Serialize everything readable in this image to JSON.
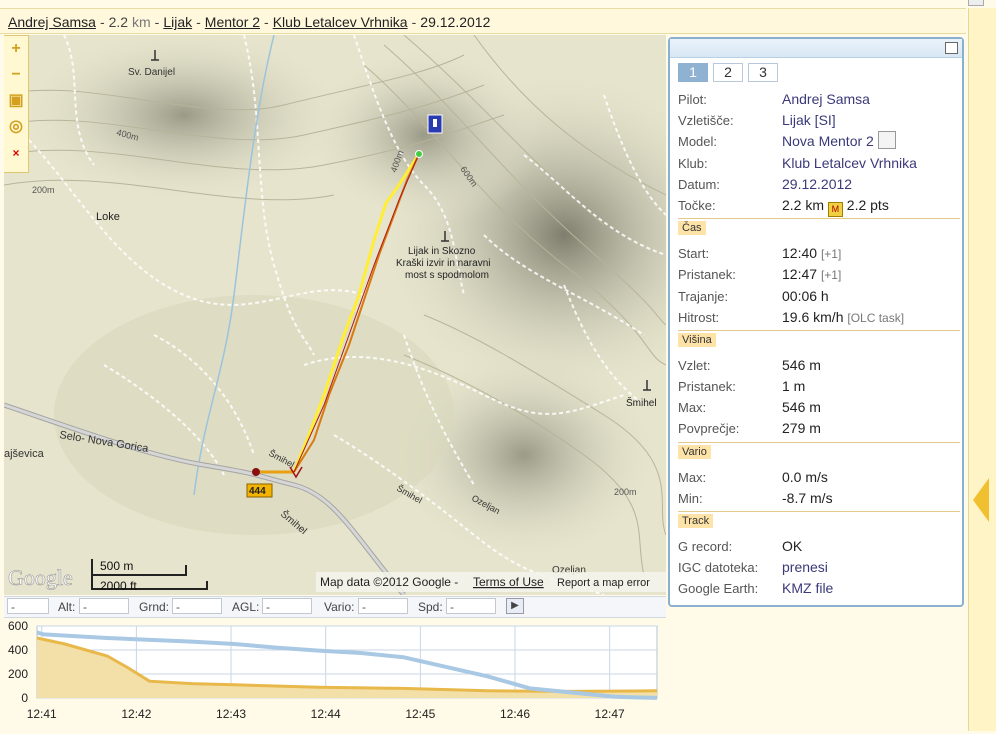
{
  "header": {
    "pilot": "Andrej Samsa",
    "distance": "2.2",
    "unit": "km",
    "takeoff": "Lijak",
    "glider": "Mentor 2",
    "club": "Klub Letalcev Vrhnika",
    "date": "29.12.2012"
  },
  "map": {
    "labels": {
      "sv_danijel": "Sv. Danijel",
      "loke": "Loke",
      "lijak": "Lijak in Skozno",
      "lijak2": "Kraški izvir in naravni",
      "lijak3": "most s spodmolom",
      "smihel": "Šmihel",
      "road": "Selo- Nova Gorica",
      "sevica": "ajševica",
      "ozeljan": "Ozeljan",
      "ozeljan2": "Ozeljan",
      "smihel2": "Šmihel",
      "smihel3": "Šmihel",
      "smihel4": "Šmihel",
      "route": "444",
      "e400": "400m",
      "e200": "200m",
      "e600": "600m",
      "e400b": "400m",
      "e200b": "200m"
    },
    "scale": {
      "metric": "500 m",
      "imperial": "2000 ft"
    },
    "google": "Google",
    "attribution": "Map data ©2012 Google -",
    "terms": "Terms of Use",
    "report": "Report a map error"
  },
  "zoom": {
    "in": "+",
    "out": "−",
    "close": "×"
  },
  "panel": {
    "tabs": [
      "1",
      "2",
      "3"
    ],
    "active_tab": "1",
    "info": {
      "pilot_label": "Pilot:",
      "pilot": "Andrej Samsa",
      "takeoff_label": "Vzletišče:",
      "takeoff": "Lijak [SI]",
      "model_label": "Model:",
      "model": "Nova Mentor 2",
      "club_label": "Klub:",
      "club": "Klub Letalcev Vrhnika",
      "date_label": "Datum:",
      "date": "29.12.2012",
      "points_label": "Točke:",
      "distance": "2.2 km",
      "olc_icon": "M",
      "points": "2.2 pts"
    },
    "time": {
      "section": "Čas",
      "start_label": "Start:",
      "start": "12:40",
      "start_tz": "[+1]",
      "landing_label": "Pristanek:",
      "landing": "12:47",
      "landing_tz": "[+1]",
      "duration_label": "Trajanje:",
      "duration": "00:06 h",
      "speed_label": "Hitrost:",
      "speed": "19.6 km/h",
      "speed_note": "[OLC task]"
    },
    "height": {
      "section": "Višina",
      "takeoff_label": "Vzlet:",
      "takeoff": "546 m",
      "landing_label": "Pristanek:",
      "landing": "1 m",
      "max_label": "Max:",
      "max": "546 m",
      "avg_label": "Povprečje:",
      "avg": "279 m"
    },
    "vario": {
      "section": "Vario",
      "max_label": "Max:",
      "max": "0.0 m/s",
      "min_label": "Min:",
      "min": "-8.7 m/s"
    },
    "track": {
      "section": "Track",
      "g_label": "G record:",
      "g": "OK",
      "igc_label": "IGC datoteka:",
      "igc": "prenesi",
      "ge_label": "Google Earth:",
      "ge": "KMZ file"
    }
  },
  "status": {
    "time_value": "-",
    "alt_label": "Alt:",
    "alt": "-",
    "grnd_label": "Grnd:",
    "grnd": "-",
    "agl_label": "AGL:",
    "agl": "-",
    "vario_label": "Vario:",
    "vario": "-",
    "spd_label": "Spd:",
    "spd": "-"
  },
  "chart_data": {
    "type": "area",
    "y_ticks": [
      "600",
      "400",
      "200",
      "0"
    ],
    "x_ticks": [
      "12:41",
      "12:42",
      "12:43",
      "12:44",
      "12:45",
      "12:46",
      "12:47"
    ],
    "ylim": [
      0,
      600
    ],
    "series": [
      {
        "color": "#a9c8e4",
        "x": [
          12.67,
          12.75,
          13.5,
          14.5,
          15.0,
          15.5,
          16.0,
          16.5,
          17.0,
          17.5,
          18.0,
          18.5,
          19.5,
          20.0
        ],
        "values": [
          546,
          530,
          500,
          470,
          450,
          420,
          395,
          375,
          340,
          260,
          180,
          80,
          10,
          1
        ]
      },
      {
        "color": "#e8b84a",
        "x": [
          12.67,
          13.0,
          13.5,
          13.75,
          14.0,
          14.5,
          15.0,
          16.0,
          17.0,
          18.0,
          19.0,
          20.0
        ],
        "values": [
          500,
          450,
          350,
          250,
          140,
          120,
          110,
          90,
          80,
          60,
          55,
          60
        ]
      }
    ]
  }
}
